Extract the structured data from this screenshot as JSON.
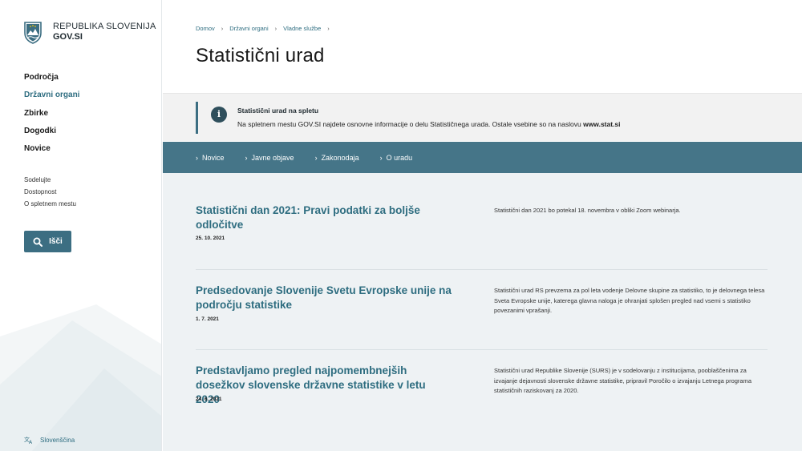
{
  "brand": {
    "line1": "REPUBLIKA SLOVENIJA",
    "line2": "GOV.SI"
  },
  "nav": {
    "items": [
      {
        "label": "Področja"
      },
      {
        "label": "Državni organi"
      },
      {
        "label": "Zbirke"
      },
      {
        "label": "Dogodki"
      },
      {
        "label": "Novice"
      }
    ]
  },
  "subnav": {
    "items": [
      {
        "label": "Sodelujte"
      },
      {
        "label": "Dostopnost"
      },
      {
        "label": "O spletnem mestu"
      }
    ]
  },
  "search": {
    "label": "Išči"
  },
  "language": {
    "label": "Slovenščina"
  },
  "breadcrumb": [
    {
      "label": "Domov"
    },
    {
      "label": "Državni organi"
    },
    {
      "label": "Vladne službe"
    }
  ],
  "page": {
    "title": "Statistični urad"
  },
  "notice": {
    "title": "Statistični urad na spletu",
    "text": "Na spletnem mestu GOV.SI najdete osnovne informacije o delu Statističnega urada. Ostale vsebine so na naslovu ",
    "link": "www.stat.si"
  },
  "tabs": [
    {
      "label": "Novice"
    },
    {
      "label": "Javne objave"
    },
    {
      "label": "Zakonodaja"
    },
    {
      "label": "O uradu"
    }
  ],
  "news": [
    {
      "title": "Statistični dan 2021: Pravi podatki za boljše odločitve",
      "date": "25. 10. 2021",
      "desc": "Statistični dan 2021 bo potekal 18. novembra v obliki Zoom webinarja."
    },
    {
      "title": "Predsedovanje Slovenije Svetu Evropske unije na področju statistike",
      "date": "1. 7. 2021",
      "desc": "Statistični urad RS prevzema za pol leta vodenje Delovne skupine za statistiko, to je delovnega telesa Sveta Evropske unije, katerega glavna naloga je ohranjati splošen pregled nad vsemi s statistiko povezanimi vprašanji."
    },
    {
      "title": "Predstavljamo pregled najpomembnejših dosežkov slovenske državne statistike v letu 2020",
      "date": "24. 6. 2021",
      "desc": "Statistični urad Republike Slovenije (SURS) je v sodelovanju z institucijama, pooblaščenima za izvajanje dejavnosti slovenske državne statistike, pripravil Poročilo o izvajanju Letnega programa statističnih raziskovanj za 2020."
    }
  ],
  "colors": {
    "accent": "#2e6d80",
    "tabbar": "#457588",
    "button": "#3c6e82",
    "content_bg": "#eef2f4"
  },
  "icons": {
    "crest": "coat-of-arms-icon",
    "search": "search-icon",
    "language": "translate-icon",
    "info": "info-icon",
    "chevron": "chevron-right-icon"
  }
}
